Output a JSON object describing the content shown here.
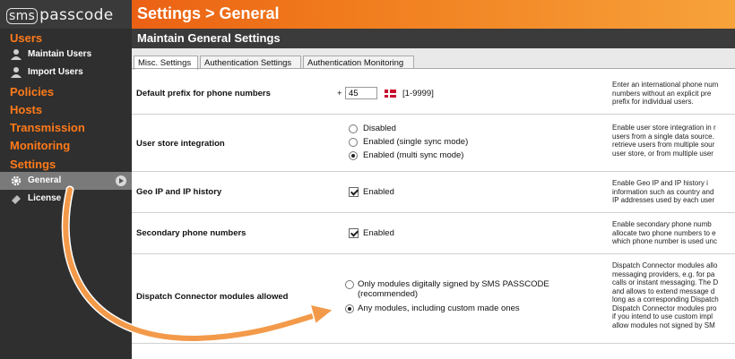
{
  "app": {
    "logo_sms": "sms",
    "logo_text": "passcode",
    "title": "Settings > General"
  },
  "sidebar": {
    "users": "Users",
    "maintain_users": "Maintain Users",
    "import_users": "Import Users",
    "policies": "Policies",
    "hosts": "Hosts",
    "transmission": "Transmission",
    "monitoring": "Monitoring",
    "settings": "Settings",
    "general": "General",
    "license": "License"
  },
  "main": {
    "section_title": "Maintain General Settings",
    "tabs": [
      {
        "label": "Misc. Settings"
      },
      {
        "label": "Authentication Settings"
      },
      {
        "label": "Authentication Monitoring"
      }
    ],
    "rows": {
      "prefix": {
        "label": "Default prefix for phone numbers",
        "plus": "+",
        "value": "45",
        "range": "[1-9999]",
        "desc": [
          "Enter an international phone num",
          "numbers without an explicit pre",
          "prefix for individual users."
        ]
      },
      "store": {
        "label": "User store integration",
        "options": [
          "Disabled",
          "Enabled (single sync mode)",
          "Enabled (multi sync mode)"
        ],
        "selected": 2,
        "desc": [
          "Enable user store integration in r",
          "users from a single data source.",
          "retrieve users from multiple sour",
          "user store, or from multiple user"
        ]
      },
      "geo": {
        "label": "Geo IP and IP history",
        "checkbox_label": "Enabled",
        "desc": [
          "Enable Geo IP and IP history i",
          "information such as country and",
          "IP addresses used by each user"
        ]
      },
      "secondary": {
        "label": "Secondary phone numbers",
        "checkbox_label": "Enabled",
        "desc": [
          "Enable secondary phone numb",
          "allocate two phone numbers to e",
          "which phone number is used unc"
        ]
      },
      "dispatch": {
        "label": "Dispatch Connector modules allowed",
        "option1_line1": "Only modules digitally signed by SMS PASSCODE",
        "option1_line2": "(recommended)",
        "option2": "Any modules, including custom made ones",
        "desc": [
          "Dispatch Connector modules allo",
          "messaging providers, e.g. for pa",
          "calls or instant messaging. The D",
          "and allows to extend message d",
          "long as a corresponding Dispatch",
          "Dispatch Connector modules pro",
          "if you intend to use custom impl",
          "allow modules not signed by SM"
        ]
      }
    }
  },
  "colors": {
    "accent": "#f07a1c",
    "sidebar_bg": "#2f2f2f",
    "nav_category": "#ff7a1a",
    "arrow": "#f39a4a"
  }
}
